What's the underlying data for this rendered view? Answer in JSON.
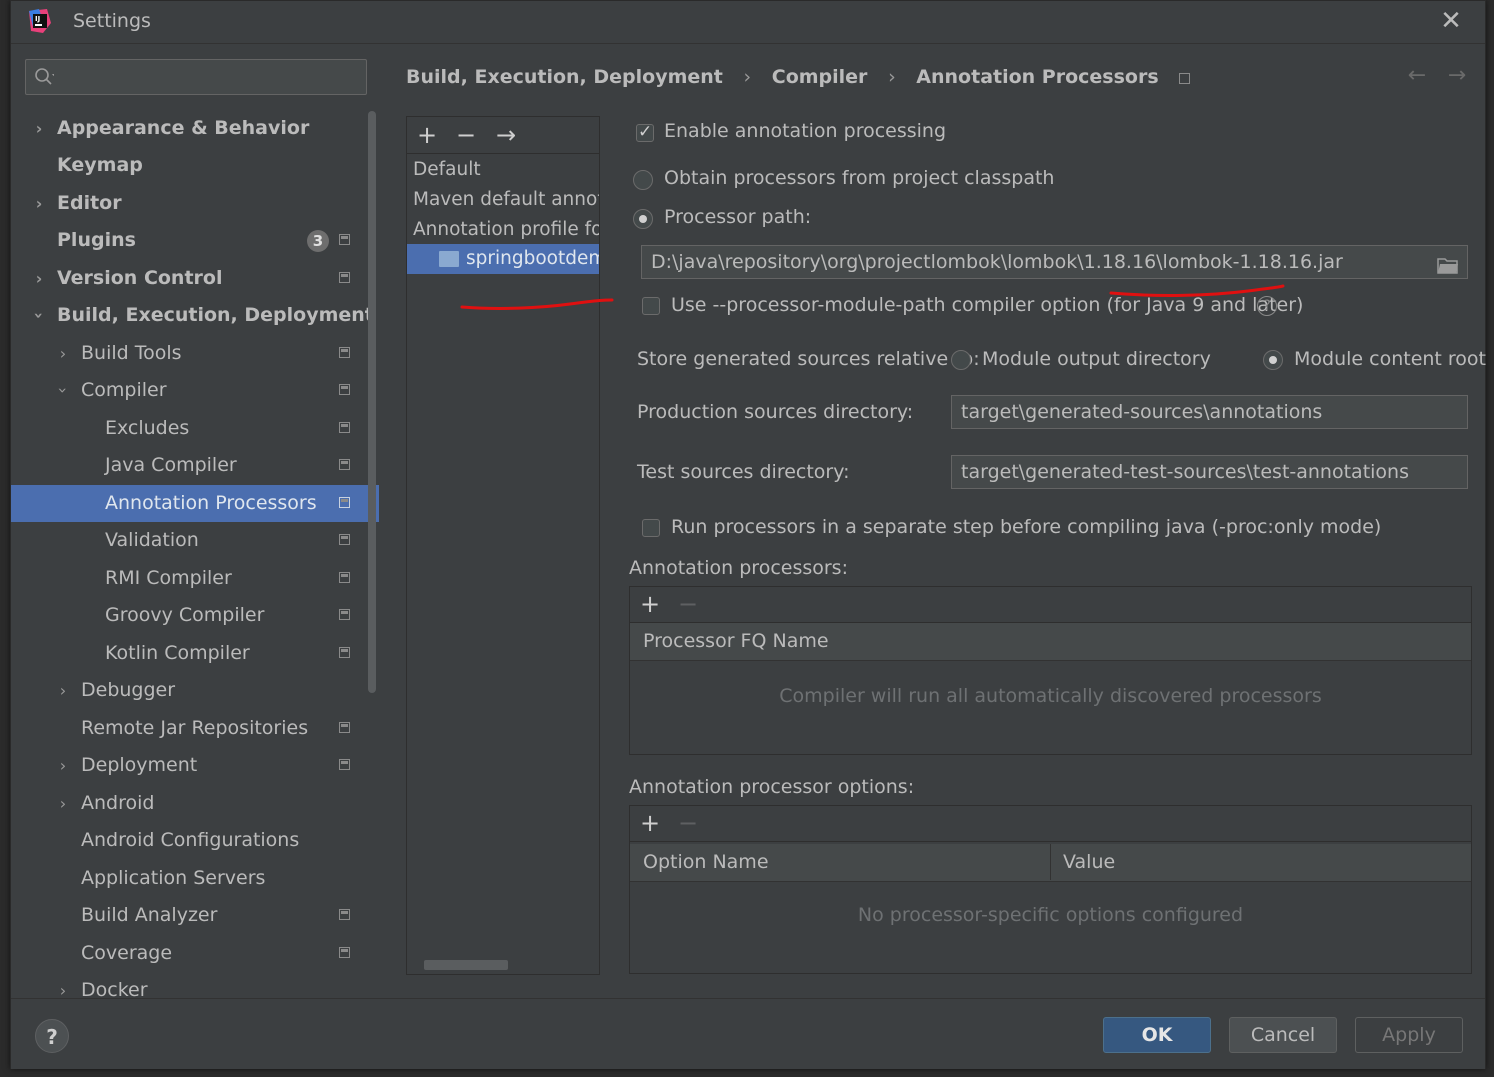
{
  "window": {
    "title": "Settings"
  },
  "search": {
    "placeholder": ""
  },
  "sidebar": {
    "items": [
      {
        "label": "Appearance & Behavior"
      },
      {
        "label": "Keymap"
      },
      {
        "label": "Editor"
      },
      {
        "label": "Plugins",
        "badge": "3"
      },
      {
        "label": "Version Control"
      },
      {
        "label": "Build, Execution, Deployment"
      },
      {
        "label": "Build Tools"
      },
      {
        "label": "Compiler"
      },
      {
        "label": "Excludes"
      },
      {
        "label": "Java Compiler"
      },
      {
        "label": "Annotation Processors"
      },
      {
        "label": "Validation"
      },
      {
        "label": "RMI Compiler"
      },
      {
        "label": "Groovy Compiler"
      },
      {
        "label": "Kotlin Compiler"
      },
      {
        "label": "Debugger"
      },
      {
        "label": "Remote Jar Repositories"
      },
      {
        "label": "Deployment"
      },
      {
        "label": "Android"
      },
      {
        "label": "Android Configurations"
      },
      {
        "label": "Application Servers"
      },
      {
        "label": "Build Analyzer"
      },
      {
        "label": "Coverage"
      },
      {
        "label": "Docker"
      }
    ]
  },
  "breadcrumb": {
    "part1": "Build, Execution, Deployment",
    "part2": "Compiler",
    "part3": "Annotation Processors",
    "sep": "›"
  },
  "profiles": {
    "items": [
      "Default",
      "Maven default annotation processors profile",
      "Annotation profile for springbootdemo",
      "springbootdemo"
    ]
  },
  "settings": {
    "enable_label": "Enable annotation processing",
    "enable_checked": true,
    "obtain_label": "Obtain processors from project classpath",
    "processor_path_label": "Processor path:",
    "processor_path_value": "D:\\java\\repository\\org\\projectlombok\\lombok\\1.18.16\\lombok-1.18.16.jar",
    "module_path_label": "Use --processor-module-path compiler option (for Java 9 and later)",
    "store_label": "Store generated sources relative to:",
    "module_output_label": "Module output directory",
    "module_content_label": "Module content root",
    "prod_dir_label": "Production sources directory:",
    "prod_dir_value": "target\\generated-sources\\annotations",
    "test_dir_label": "Test sources directory:",
    "test_dir_value": "target\\generated-test-sources\\test-annotations",
    "separate_step_label": "Run processors in a separate step before compiling java (-proc:only mode)"
  },
  "processors_table": {
    "title": "Annotation processors:",
    "column": "Processor FQ Name",
    "empty_text": "Compiler will run all automatically discovered processors"
  },
  "options_table": {
    "title": "Annotation processor options:",
    "col1": "Option Name",
    "col2": "Value",
    "empty_text": "No processor-specific options configured"
  },
  "footer": {
    "help": "?",
    "ok": "OK",
    "cancel": "Cancel",
    "apply": "Apply"
  },
  "colors": {
    "selection": "#4b6eaf",
    "background": "#3c3f41",
    "primary_button": "#365880",
    "annotation": "#e01010"
  }
}
